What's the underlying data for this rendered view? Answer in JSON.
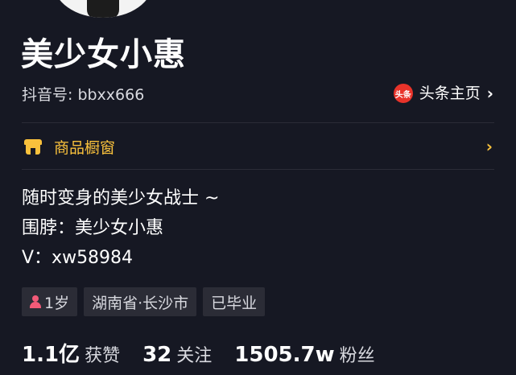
{
  "profile": {
    "name": "美少女小惠",
    "douyin_id": "抖音号: bbxx666"
  },
  "toutiao": {
    "icon_text": "头条",
    "label": "头条主页",
    "icon_color": "#e8332a"
  },
  "shop": {
    "label": "商品橱窗",
    "accent_color": "#f9c13c"
  },
  "bio": {
    "lines": [
      "随时变身的美少女战士 ~",
      "围脖：美少女小惠",
      "V：xw58984"
    ]
  },
  "tags": [
    {
      "label": "1岁",
      "icon": "female-icon"
    },
    {
      "label": "湖南省·长沙市"
    },
    {
      "label": "已毕业"
    }
  ],
  "stats": [
    {
      "value": "1.1亿",
      "label": "获赞"
    },
    {
      "value": "32",
      "label": "关注"
    },
    {
      "value": "1505.7w",
      "label": "粉丝"
    }
  ],
  "icons": {
    "chevron": "chevron-right-icon",
    "shop": "storefront-icon"
  },
  "colors": {
    "background": "#161823",
    "female": "#f25a78"
  }
}
